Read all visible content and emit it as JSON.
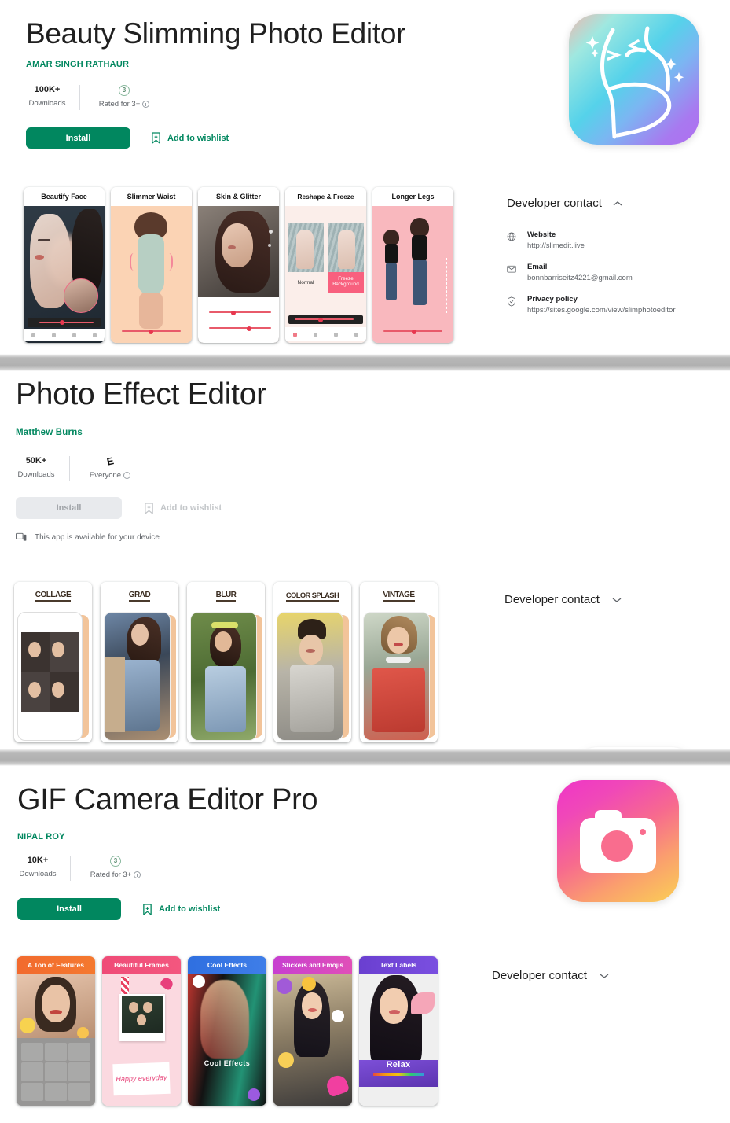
{
  "apps": [
    {
      "title": "Beauty Slimming Photo Editor",
      "developer": "AMAR SINGH RATHAUR",
      "downloads_value": "100K+",
      "downloads_label": "Downloads",
      "rating_badge_text": "3",
      "rating_label": "Rated for 3+",
      "install_label": "Install",
      "wishlist_label": "Add to wishlist",
      "install_enabled": true,
      "device_note": "",
      "icon": "slimming-body-icon",
      "developer_contact": {
        "heading": "Developer contact",
        "expanded": true,
        "chevron": "chevron-up-icon",
        "rows": [
          {
            "icon": "globe-icon",
            "label": "Website",
            "value": "http://slimedit.live"
          },
          {
            "icon": "mail-icon",
            "label": "Email",
            "value": "bonnbarriseitz4221@gmail.com"
          },
          {
            "icon": "shield-icon",
            "label": "Privacy policy",
            "value": "https://sites.google.com/view/slimphotoeditor"
          }
        ]
      },
      "screenshots": [
        {
          "caption": "Beautify Face",
          "style": "beautify"
        },
        {
          "caption": "Slimmer Waist",
          "style": "waist"
        },
        {
          "caption": "Skin & Glitter",
          "style": "glitter"
        },
        {
          "caption": "Reshape & Freeze",
          "style": "freeze",
          "sub_labels": [
            "Normal",
            "Freeze Background"
          ]
        },
        {
          "caption": "Longer Legs",
          "style": "legs"
        }
      ]
    },
    {
      "title": "Photo Effect Editor",
      "developer": "Matthew Burns",
      "downloads_value": "50K+",
      "downloads_label": "Downloads",
      "rating_badge_text": "E",
      "rating_label": "Everyone",
      "install_label": "Install",
      "wishlist_label": "Add to wishlist",
      "install_enabled": false,
      "device_note": "This app is available for your device",
      "icon": "grid-squares-icon",
      "developer_contact": {
        "heading": "Developer contact",
        "expanded": false,
        "chevron": "chevron-down-icon",
        "rows": []
      },
      "screenshots": [
        {
          "caption": "COLLAGE",
          "style": "collage"
        },
        {
          "caption": "GRAD",
          "style": "grad"
        },
        {
          "caption": "BLUR",
          "style": "blur"
        },
        {
          "caption": "COLOR SPLASH",
          "style": "splash"
        },
        {
          "caption": "VINTAGE",
          "style": "vintage"
        }
      ]
    },
    {
      "title": "GIF Camera Editor Pro",
      "developer": "NIPAL ROY",
      "downloads_value": "10K+",
      "downloads_label": "Downloads",
      "rating_badge_text": "3",
      "rating_label": "Rated for 3+",
      "install_label": "Install",
      "wishlist_label": "Add to wishlist",
      "install_enabled": true,
      "device_note": "",
      "icon": "camera-icon",
      "developer_contact": {
        "heading": "Developer contact",
        "expanded": false,
        "chevron": "chevron-down-icon",
        "rows": []
      },
      "screenshots": [
        {
          "caption": "A Ton of Features",
          "style": "features"
        },
        {
          "caption": "Beautiful Frames",
          "style": "frames",
          "overlay_text": "Happy everyday"
        },
        {
          "caption": "Cool Effects",
          "style": "effects",
          "overlay_text": "Cool Effects"
        },
        {
          "caption": "Stickers and Emojis",
          "style": "stickers"
        },
        {
          "caption": "Text Labels",
          "style": "labels",
          "overlay_text": "Relax"
        }
      ]
    }
  ],
  "colors": {
    "brand_green": "#01875f",
    "title_text": "#1f1f1f",
    "muted_text": "#5f6368",
    "disabled_bg": "#e8eaed"
  }
}
